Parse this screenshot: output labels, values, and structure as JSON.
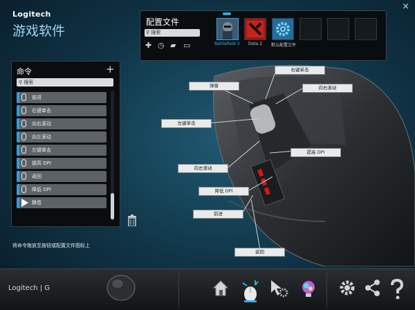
{
  "header": {
    "brand": "Logitech",
    "app_title": "游戏软件",
    "close": "×"
  },
  "profiles": {
    "title": "配置文件",
    "search_placeholder": "搜索",
    "toolbar_icons": [
      "add-icon",
      "clock-icon",
      "folder-icon",
      "printer-icon"
    ],
    "slots": [
      {
        "label": "Battlefield 3",
        "active": true
      },
      {
        "label": "Dota 2",
        "active": false
      },
      {
        "label": "默认配置文件",
        "active": false
      },
      {
        "label": "",
        "active": false
      },
      {
        "label": "",
        "active": false
      },
      {
        "label": "",
        "active": false
      }
    ]
  },
  "commands": {
    "title": "命令",
    "add": "+",
    "search_placeholder": "搜索",
    "items": [
      {
        "label": "前进"
      },
      {
        "label": "右键单击"
      },
      {
        "label": "向右滚动"
      },
      {
        "label": "向左滚动"
      },
      {
        "label": "左键单击"
      },
      {
        "label": "提高 DPI"
      },
      {
        "label": "返回"
      },
      {
        "label": "降低 DPI"
      },
      {
        "label": "静音"
      }
    ],
    "hint": "将命令拖放至按钮或配置文件图标上"
  },
  "callouts": {
    "right_click": "右键单击",
    "middle": "弹窗",
    "scroll_right": "向右滚动",
    "left_click": "左键单击",
    "dpi_up": "提高 DPI",
    "scroll_left": "向左滚动",
    "dpi_down": "降低 DPI",
    "forward": "前进",
    "back": "返回"
  },
  "bottom": {
    "logo": "Logitech | G",
    "icons": [
      "home-icon",
      "pointer-settings-icon",
      "cursor-gear-icon",
      "lighting-icon",
      "settings-icon",
      "share-icon",
      "help-icon"
    ]
  },
  "colors": {
    "accent": "#2d9fe0",
    "background": "#0f3244",
    "panel": "#0a0c0e"
  }
}
